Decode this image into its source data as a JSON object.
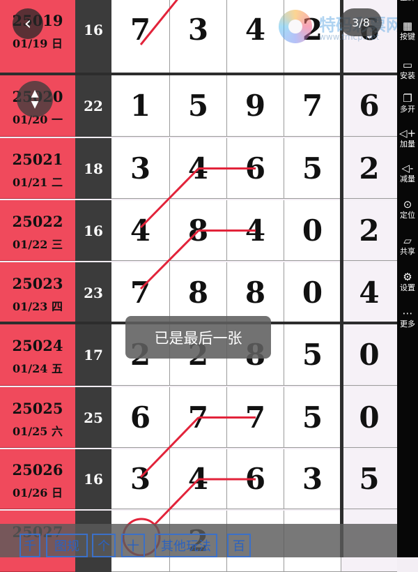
{
  "draws": [
    {
      "issue": "25019",
      "date": "01/19 日",
      "sum": "16",
      "digits": [
        "7",
        "3",
        "4",
        "2",
        "6"
      ]
    },
    {
      "issue": "25020",
      "date": "01/20 一",
      "sum": "22",
      "digits": [
        "1",
        "5",
        "9",
        "7",
        "6"
      ]
    },
    {
      "issue": "25021",
      "date": "01/21 二",
      "sum": "18",
      "digits": [
        "3",
        "4",
        "6",
        "5",
        "2"
      ]
    },
    {
      "issue": "25022",
      "date": "01/22 三",
      "sum": "16",
      "digits": [
        "4",
        "8",
        "4",
        "0",
        "2"
      ]
    },
    {
      "issue": "25023",
      "date": "01/23 四",
      "sum": "23",
      "digits": [
        "7",
        "8",
        "8",
        "0",
        "4"
      ]
    },
    {
      "issue": "25024",
      "date": "01/24 五",
      "sum": "17",
      "digits": [
        "2",
        "2",
        "8",
        "5",
        "0"
      ]
    },
    {
      "issue": "25025",
      "date": "01/25 六",
      "sum": "25",
      "digits": [
        "6",
        "7",
        "7",
        "5",
        "0"
      ]
    },
    {
      "issue": "25026",
      "date": "01/26 日",
      "sum": "16",
      "digits": [
        "3",
        "4",
        "6",
        "3",
        "5"
      ]
    },
    {
      "issue": "25027",
      "date": "",
      "sum": "",
      "digits": [
        "",
        "2",
        "",
        "",
        ""
      ]
    }
  ],
  "colors": {
    "date_bg": "#f04a5c",
    "sum_bg": "#3b3b3b",
    "line": "#e2233a",
    "tab": "#2a62c0"
  },
  "viewer": {
    "back_icon": "chevron-left-icon",
    "scroll_icon": "up-down-arrows-icon",
    "page_counter": "3/8",
    "toast": "已是最后一张"
  },
  "watermark": {
    "text": "特码彩票网",
    "url": "www.tmcp.net"
  },
  "sidebar": {
    "items": [
      {
        "icon": "fullscreen-icon",
        "label": "全屏"
      },
      {
        "icon": "keyboard-icon",
        "label": "按键"
      },
      {
        "icon": "apk-install-icon",
        "label": "安装"
      },
      {
        "icon": "multi-window-icon",
        "label": "多开"
      },
      {
        "icon": "volume-up-icon",
        "label": "加量"
      },
      {
        "icon": "volume-down-icon",
        "label": "减量"
      },
      {
        "icon": "location-icon",
        "label": "定位"
      },
      {
        "icon": "folder-share-icon",
        "label": "共享"
      },
      {
        "icon": "gear-icon",
        "label": "设置"
      },
      {
        "icon": "more-dots-icon",
        "label": "更多"
      }
    ]
  },
  "tabs": [
    {
      "label": "千"
    },
    {
      "label": "图规"
    },
    {
      "label": "个"
    },
    {
      "label": "十"
    },
    {
      "label": "其他玩法"
    },
    {
      "label": "百"
    }
  ]
}
